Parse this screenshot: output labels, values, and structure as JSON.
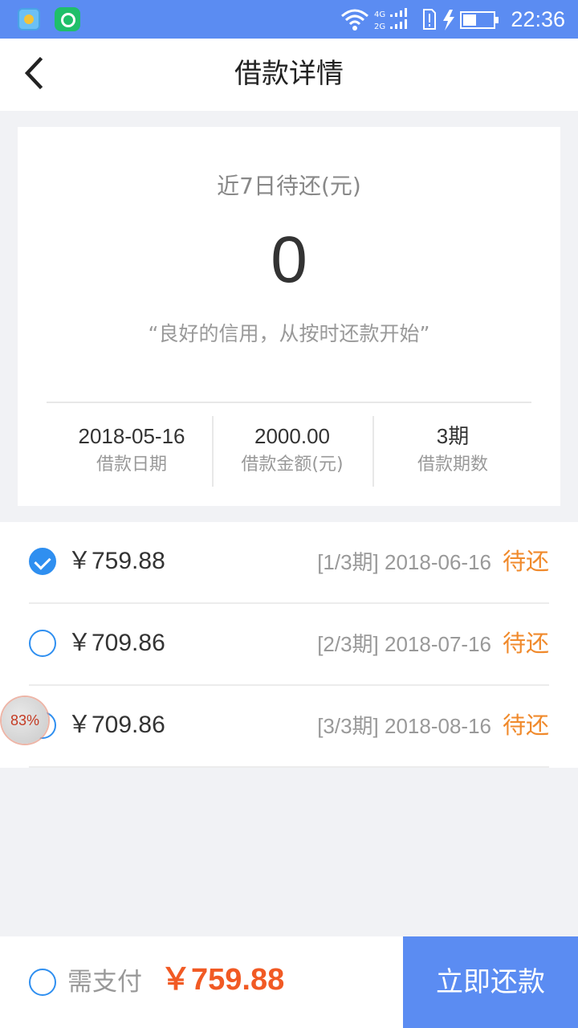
{
  "status_bar": {
    "time": "22:36",
    "network_top": "4G",
    "network_bottom": "2G",
    "battery_level": 0.45,
    "icons": [
      "app-icon",
      "support-app-icon",
      "wifi-icon",
      "signal-icon",
      "sim-alert-icon",
      "charging-icon",
      "battery-icon"
    ]
  },
  "header": {
    "title": "借款详情",
    "back_icon": "chevron-left-icon"
  },
  "summary": {
    "label": "近7日待还(元)",
    "amount": "0",
    "slogan": "“良好的信用，从按时还款开始”",
    "stats": [
      {
        "value": "2018-05-16",
        "label": "借款日期"
      },
      {
        "value": "2000.00",
        "label": "借款金额(元)"
      },
      {
        "value": "3期",
        "label": "借款期数"
      }
    ]
  },
  "installments": [
    {
      "amount": "￥759.88",
      "period": "[1/3期] 2018-06-16",
      "status": "待还",
      "checked": true
    },
    {
      "amount": "￥709.86",
      "period": "[2/3期] 2018-07-16",
      "status": "待还",
      "checked": false
    },
    {
      "amount": "￥709.86",
      "period": "[3/3期] 2018-08-16",
      "status": "待还",
      "checked": false
    }
  ],
  "floating_badge": "83%",
  "bottom_bar": {
    "need_pay_label": "需支付",
    "total": "￥759.88",
    "pay_button": "立即还款"
  },
  "colors": {
    "primary": "#5b8cf2",
    "check_blue": "#2f8ff0",
    "status_orange": "#f08a2c",
    "total_red": "#f15a24"
  }
}
